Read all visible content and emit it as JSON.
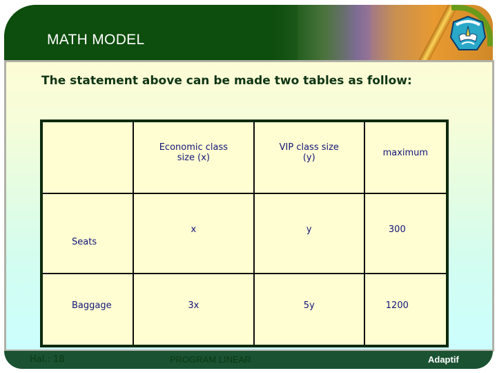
{
  "header": {
    "title": "MATH MODEL",
    "logo_icon": "ministry-emblem-icon",
    "decoration_icon": "fountain-pen-icon"
  },
  "content": {
    "statement": "The statement above can be made two tables as follow:",
    "table": {
      "columns": [
        "",
        "Economic class size (x)",
        "VIP class size (y)",
        "maximum"
      ],
      "rows": [
        {
          "label": "Seats",
          "cells": [
            "x",
            "y",
            "300"
          ]
        },
        {
          "label": "Baggage",
          "cells": [
            "3x",
            "5y",
            "1200"
          ]
        }
      ]
    }
  },
  "footer": {
    "page": "Hal.: 18",
    "course": "PROGRAM LINEAR",
    "brand": "Adaptif"
  },
  "colors": {
    "header_green": "#0d4d0d",
    "footer_green": "#1a5232",
    "table_text": "#14147a",
    "table_bg": "#fefed2"
  }
}
